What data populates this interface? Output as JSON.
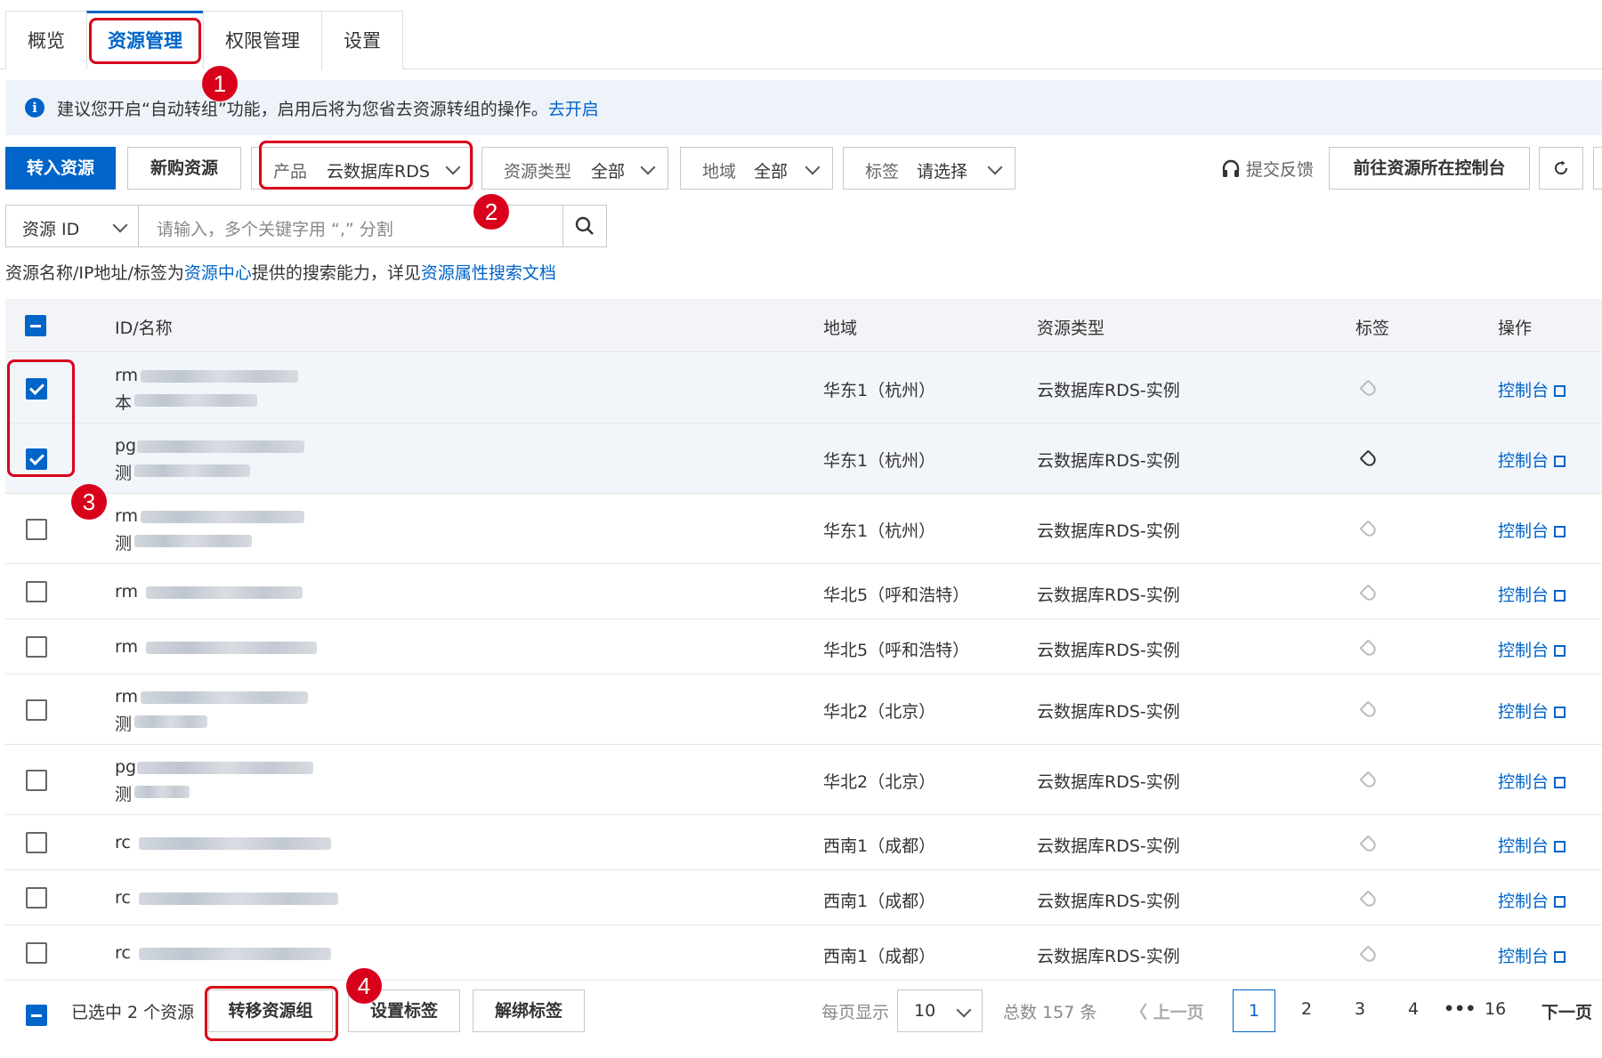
{
  "tabs": [
    "概览",
    "资源管理",
    "权限管理",
    "设置"
  ],
  "notice": {
    "icon": "info-icon",
    "text": "建议您开启“自动转组”功能，启用后将为您省去资源转组的操作。",
    "link": "去开启"
  },
  "toolbar": {
    "import_label": "转入资源",
    "buy_label": "新购资源",
    "product_label": "产品",
    "product_value": "云数据库RDS",
    "type_label": "资源类型",
    "type_value": "全部",
    "region_label": "地域",
    "region_value": "全部",
    "tag_label": "标签",
    "tag_value": "请选择",
    "feedback_label": "提交反馈",
    "console_label": "前往资源所在控制台"
  },
  "search": {
    "field": "资源 ID",
    "placeholder": "请输入，多个关键字用 “,” 分割"
  },
  "hint": {
    "prefix": "资源名称/IP地址/标签为",
    "link1": "资源中心",
    "middle": "提供的搜索能力，详见",
    "link2": "资源属性搜索文档"
  },
  "table": {
    "headers": [
      "ID/名称",
      "地域",
      "资源类型",
      "标签",
      "操作"
    ],
    "rows": [
      {
        "id": "rm",
        "name": "本",
        "region": "华东1（杭州）",
        "type": "云数据库RDS-实例",
        "action": "控制台",
        "checked": true
      },
      {
        "id": "pg",
        "name": "测",
        "region": "华东1（杭州）",
        "type": "云数据库RDS-实例",
        "action": "控制台",
        "checked": true
      },
      {
        "id": "rm",
        "name": "测",
        "region": "华东1（杭州）",
        "type": "云数据库RDS-实例",
        "action": "控制台",
        "checked": false
      },
      {
        "id": "rm",
        "name": "",
        "region": "华北5（呼和浩特）",
        "type": "云数据库RDS-实例",
        "action": "控制台",
        "checked": false
      },
      {
        "id": "rm",
        "name": "",
        "region": "华北5（呼和浩特）",
        "type": "云数据库RDS-实例",
        "action": "控制台",
        "checked": false
      },
      {
        "id": "rm",
        "name": "测",
        "region": "华北2（北京）",
        "type": "云数据库RDS-实例",
        "action": "控制台",
        "checked": false
      },
      {
        "id": "pg",
        "name": "测",
        "region": "华北2（北京）",
        "type": "云数据库RDS-实例",
        "action": "控制台",
        "checked": false
      },
      {
        "id": "rc",
        "name": "",
        "region": "西南1（成都）",
        "type": "云数据库RDS-实例",
        "action": "控制台",
        "checked": false
      },
      {
        "id": "rc",
        "name": "",
        "region": "西南1（成都）",
        "type": "云数据库RDS-实例",
        "action": "控制台",
        "checked": false
      },
      {
        "id": "rc",
        "name": "",
        "region": "西南1（成都）",
        "type": "云数据库RDS-实例",
        "action": "控制台",
        "checked": false
      }
    ]
  },
  "footer": {
    "selected_text": "已选中 2 个资源",
    "move_label": "转移资源组",
    "set_tag_label": "设置标签",
    "unbind_tag_label": "解绑标签",
    "per_page_label": "每页显示",
    "per_page_value": "10",
    "total_text": "总数 157 条",
    "prev_label": "上一页",
    "pages": [
      "1",
      "2",
      "3",
      "4",
      "16"
    ],
    "ellipsis": "•••",
    "next_label": "下一页"
  },
  "steps": [
    "1",
    "2",
    "3",
    "4"
  ],
  "colors": {
    "primary": "#0064c8",
    "highlight": "#d9001b"
  }
}
